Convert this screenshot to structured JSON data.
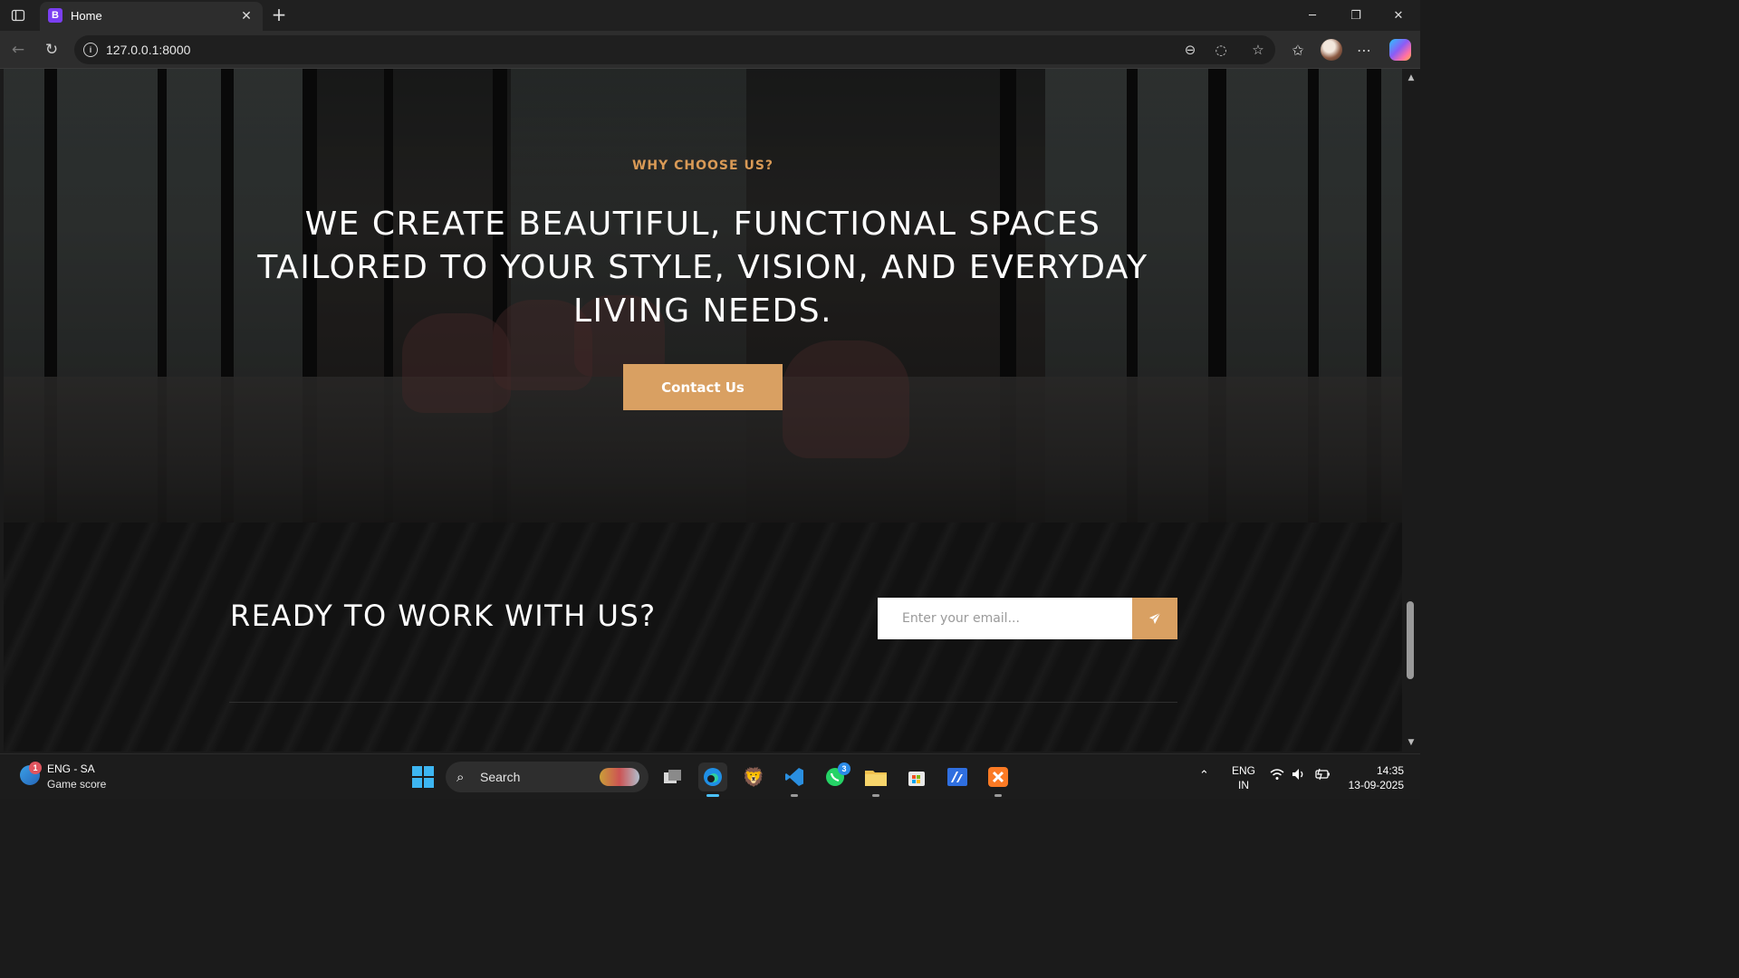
{
  "browser": {
    "tab_title": "Home",
    "tab_favicon_letter": "B",
    "url": "127.0.0.1:8000"
  },
  "hero": {
    "eyebrow": "WHY CHOOSE US?",
    "headline": "WE CREATE BEAUTIFUL, FUNCTIONAL SPACES TAILORED TO YOUR STYLE, VISION, AND EVERYDAY LIVING NEEDS.",
    "cta_label": "Contact Us"
  },
  "newsletter": {
    "heading": "READY TO WORK WITH US?",
    "email_placeholder": "Enter your email..."
  },
  "taskbar": {
    "score_badge": "1",
    "score_title": "ENG - SA",
    "score_subtitle": "Game score",
    "search_label": "Search",
    "whatsapp_badge": "3",
    "lang_line1": "ENG",
    "lang_line2": "IN",
    "time": "14:35",
    "date": "13-09-2025"
  },
  "colors": {
    "accent": "#d9a062",
    "eyebrow": "#d99a56",
    "favicon": "#7b3ff2"
  },
  "icons": {
    "tab_actions": "sidebar-toggle-icon",
    "favicon": "bootstrap-icon",
    "send": "paper-plane-icon"
  }
}
